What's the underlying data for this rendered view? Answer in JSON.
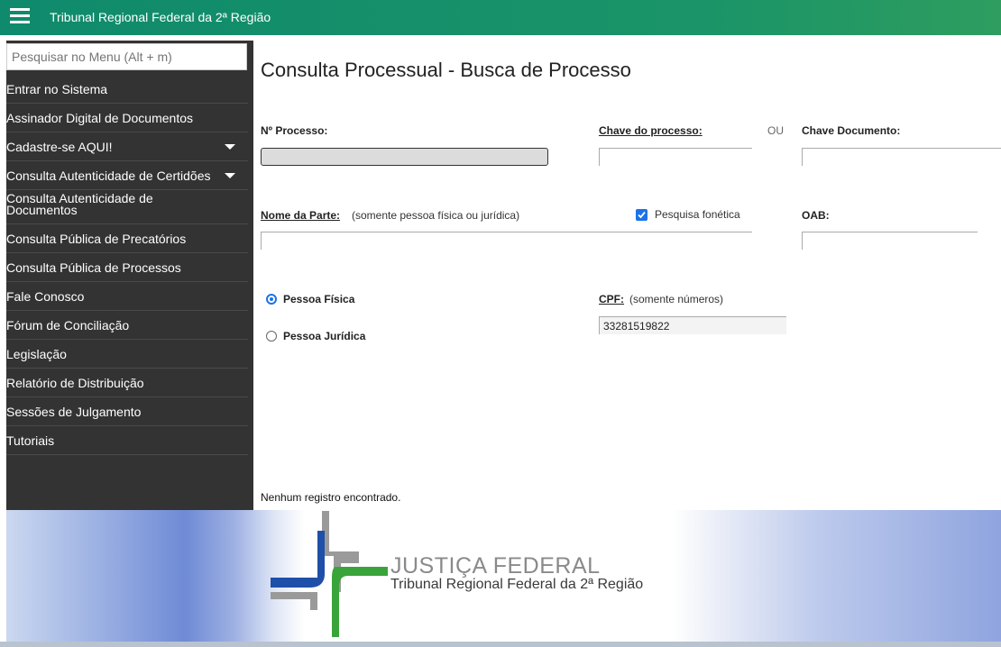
{
  "header": {
    "title": "Tribunal Regional Federal da 2ª Região"
  },
  "sidebar": {
    "search_placeholder": "Pesquisar no Menu (Alt + m)",
    "items": [
      {
        "label": "Entrar no Sistema"
      },
      {
        "label": "Assinador Digital de Documentos"
      },
      {
        "label": "Cadastre-se AQUI!",
        "expandable": true
      },
      {
        "label": "Consulta Autenticidade de Certidões",
        "expandable": true
      },
      {
        "label": "Consulta Autenticidade de Documentos"
      },
      {
        "label": "Consulta Pública de Precatórios"
      },
      {
        "label": "Consulta Pública de Processos"
      },
      {
        "label": "Fale Conosco"
      },
      {
        "label": "Fórum de Conciliação"
      },
      {
        "label": "Legislação"
      },
      {
        "label": "Relatório de Distribuição"
      },
      {
        "label": "Sessões de Julgamento"
      },
      {
        "label": "Tutoriais"
      }
    ]
  },
  "form": {
    "title": "Consulta Processual - Busca de Processo",
    "numero_processo": {
      "label": "Nº Processo:",
      "value": ""
    },
    "chave_processo": {
      "label": "Chave do processo:",
      "value": ""
    },
    "ou": "OU",
    "chave_documento": {
      "label": "Chave Documento:",
      "value": ""
    },
    "nome_parte": {
      "label": "Nome da Parte:",
      "hint": "(somente pessoa física ou jurídica)",
      "value": ""
    },
    "pesquisa_fonetica": {
      "label": "Pesquisa fonética",
      "checked": true
    },
    "oab": {
      "label": "OAB:",
      "value": ""
    },
    "pessoa_fisica": {
      "label": "Pessoa Física",
      "selected": true
    },
    "pessoa_juridica": {
      "label": "Pessoa Jurídica",
      "selected": false
    },
    "cpf": {
      "label": "CPF:",
      "hint": "(somente números)",
      "value": "33281519822"
    }
  },
  "results": {
    "message": "Nenhum registro encontrado."
  },
  "banner": {
    "line1": "JUSTIÇA FEDERAL",
    "line2": "Tribunal Regional Federal da 2ª Região"
  },
  "colors": {
    "header_green": "#0f8a6c",
    "sidebar_bg": "#333333",
    "accent_blue": "#1a73e8",
    "logo_blue": "#1f4fa8",
    "logo_green": "#3aa43a",
    "logo_gray": "#9a9a9a"
  }
}
